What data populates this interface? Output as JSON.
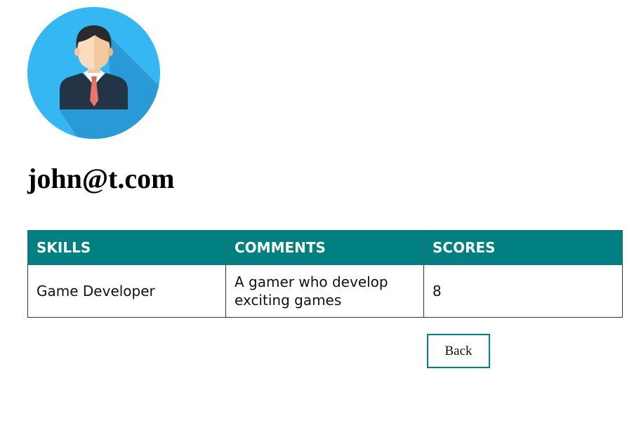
{
  "profile": {
    "avatar_icon": "user-avatar-icon",
    "email": "john@t.com"
  },
  "table": {
    "headers": [
      "SKILLS",
      "COMMENTS",
      "SCORES"
    ],
    "rows": [
      {
        "skill": "Game Developer",
        "comment": "A gamer who develop exciting games",
        "score": "8"
      }
    ]
  },
  "actions": {
    "back_label": "Back"
  },
  "colors": {
    "header_bg": "#008080",
    "avatar_bg": "#33b5f0",
    "button_border": "#008080"
  }
}
